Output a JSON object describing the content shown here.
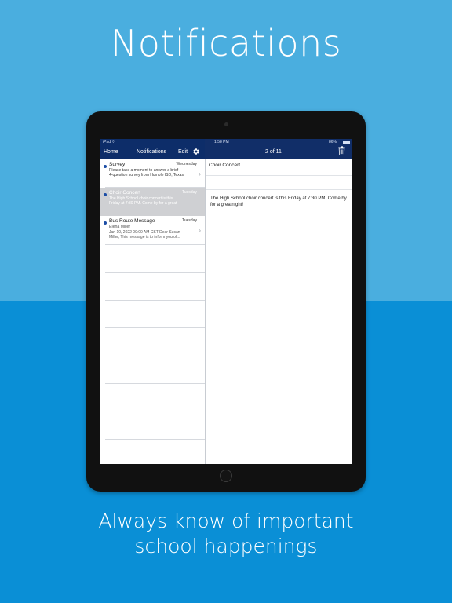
{
  "headline": "Notifications",
  "caption_line1": "Always know of important",
  "caption_line2": "school happenings",
  "device": {
    "status_left": "iPad",
    "time": "1:58 PM",
    "battery": "86%"
  },
  "left_nav": {
    "home": "Home",
    "title": "Notifications",
    "edit": "Edit"
  },
  "right_nav": {
    "counter": "2 of 11"
  },
  "messages": [
    {
      "title": "Survey",
      "day": "Wednesday",
      "line1": "Please take a moment to answer a brief",
      "line2": "4-question survey from Humble ISD, Texas."
    },
    {
      "title": "Choir Concert",
      "day": "Tuesday",
      "line1": "The High School choir concert is this",
      "line2": "Friday at 7:30 PM. Come by for a great"
    },
    {
      "title": "Bus Route Message",
      "day": "Tuesday",
      "sender": "Elena Miller",
      "line1": "Jan 10, 2022 09:00 AM CST Dear Susan",
      "line2": "Miller, This message is to inform you of..."
    }
  ],
  "detail": {
    "title": "Choir Concert",
    "body": "The High School choir concert is this Friday at 7:30 PM. Come by for a greatnight!"
  },
  "colors": {
    "nav_bg": "#0d2d69",
    "accent_dot": "#1b4da5",
    "bg_top": "#4aaedf",
    "bg_bottom": "#0a8fd6"
  }
}
